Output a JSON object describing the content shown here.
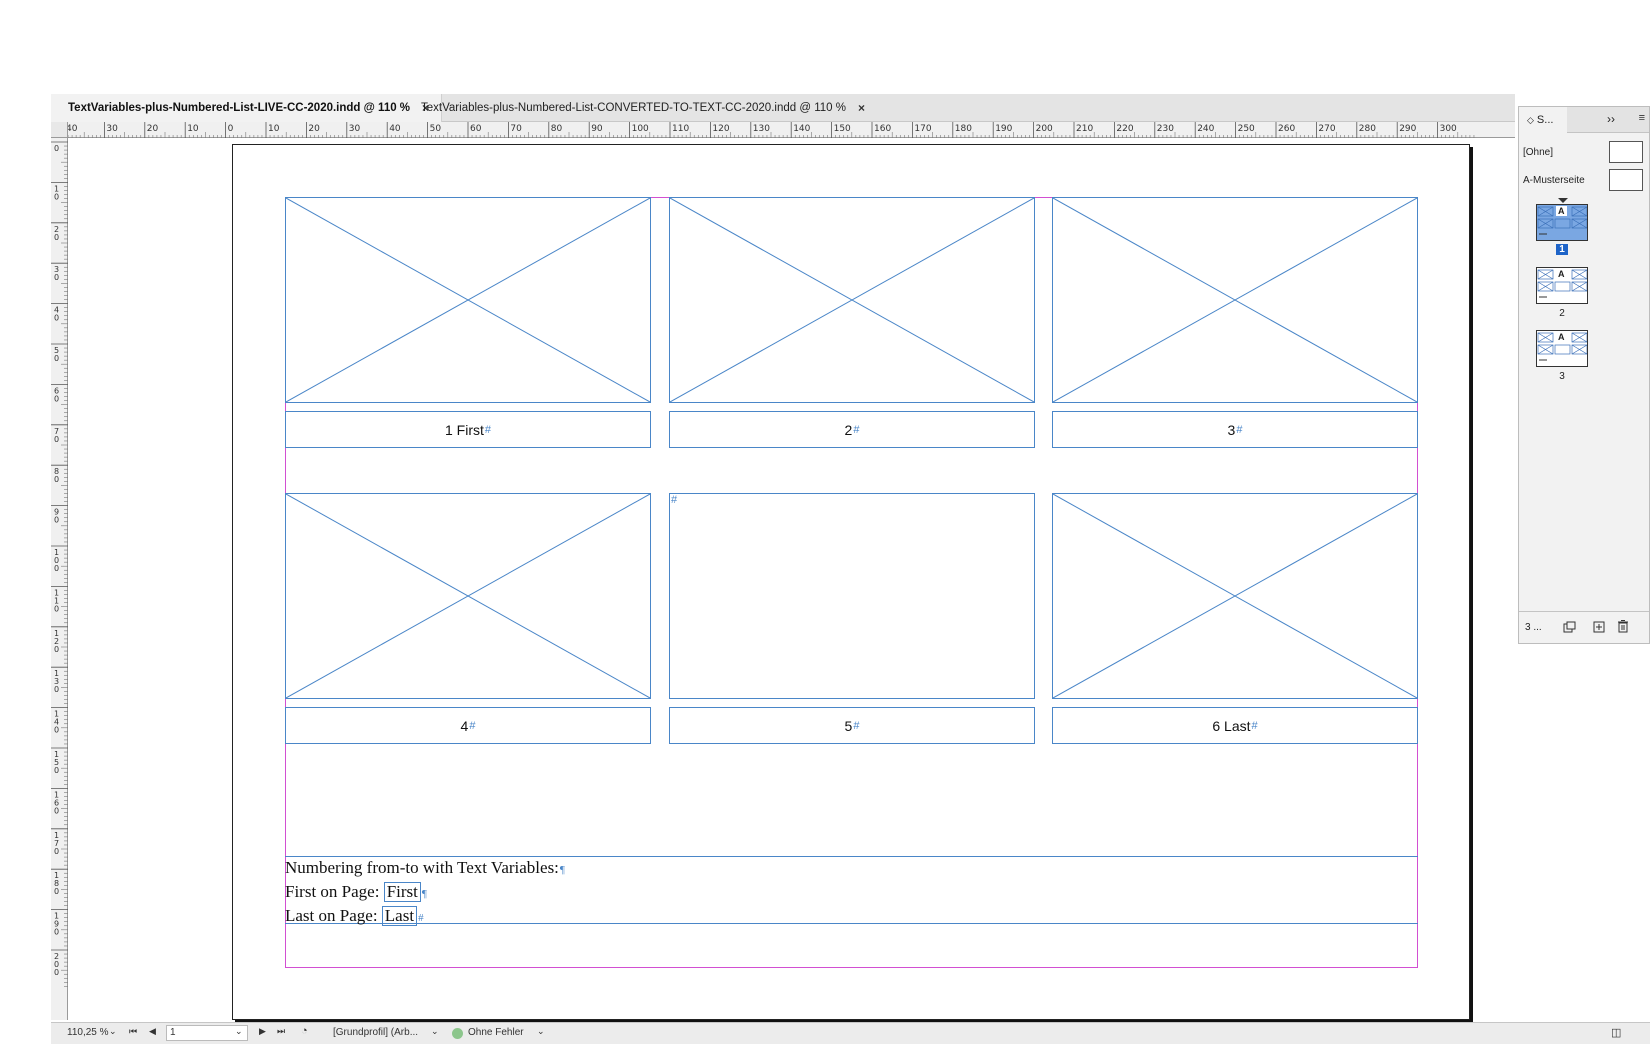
{
  "tabs": [
    {
      "label": "TextVariables-plus-Numbered-List-LIVE-CC-2020.indd @ 110 %",
      "close": "×"
    },
    {
      "label": "TextVariables-plus-Numbered-List-CONVERTED-TO-TEXT-CC-2020.indd @ 110 %",
      "close": "×"
    }
  ],
  "hruler_labels": [
    "40",
    "30",
    "20",
    "10",
    "0",
    "10",
    "20",
    "30",
    "40",
    "50",
    "60",
    "70",
    "80",
    "90",
    "100",
    "110",
    "120",
    "130",
    "140",
    "150",
    "160",
    "170",
    "180",
    "190",
    "200",
    "210",
    "220",
    "230",
    "240",
    "250",
    "260",
    "270",
    "280",
    "290",
    "300"
  ],
  "vruler_labels": [
    "0",
    "10",
    "20",
    "30",
    "40",
    "50",
    "60",
    "70",
    "80",
    "90",
    "100",
    "110",
    "120",
    "130",
    "140",
    "150",
    "160",
    "170",
    "180",
    "190",
    "200"
  ],
  "captions": [
    {
      "num": "1",
      "text": "1 First",
      "mark": "#"
    },
    {
      "num": "2",
      "text": "2",
      "mark": "#"
    },
    {
      "num": "3",
      "text": "3",
      "mark": "#"
    },
    {
      "num": "4",
      "text": "4",
      "mark": "#"
    },
    {
      "num": "5",
      "text": "5",
      "mark": "#"
    },
    {
      "num": "6",
      "text": "6 Last",
      "mark": "#"
    }
  ],
  "empty_frame_mark": "#",
  "bottom_text": {
    "line1": "Numbering from-to with Text Variables:",
    "line1_mark": "¶",
    "line2_label": "First on Page: ",
    "line2_var": "First",
    "line2_mark": "¶",
    "line3_label": "Last on Page: ",
    "line3_var": "Last",
    "line3_mark": "#"
  },
  "pages_panel": {
    "tab_label": "S...",
    "tab_arrows": "◇",
    "collapse": "››",
    "menu": "≡",
    "masters": [
      {
        "label": "[Ohne]"
      },
      {
        "label": "A-Musterseite"
      }
    ],
    "pages": [
      {
        "num": "1",
        "master_letter": "A",
        "selected": true
      },
      {
        "num": "2",
        "master_letter": "A",
        "selected": false
      },
      {
        "num": "3",
        "master_letter": "A",
        "selected": false
      }
    ],
    "footer_count": "3 ...",
    "footer_icons": [
      "edit-page-size-icon",
      "new-page-icon",
      "trash-icon"
    ]
  },
  "status_bar": {
    "zoom": "110,25 %",
    "page_field": "1",
    "preflight_profile": "[Grundprofil] (Arb...",
    "preflight_status": "Ohne Fehler",
    "status_color": "#8cc68c"
  }
}
